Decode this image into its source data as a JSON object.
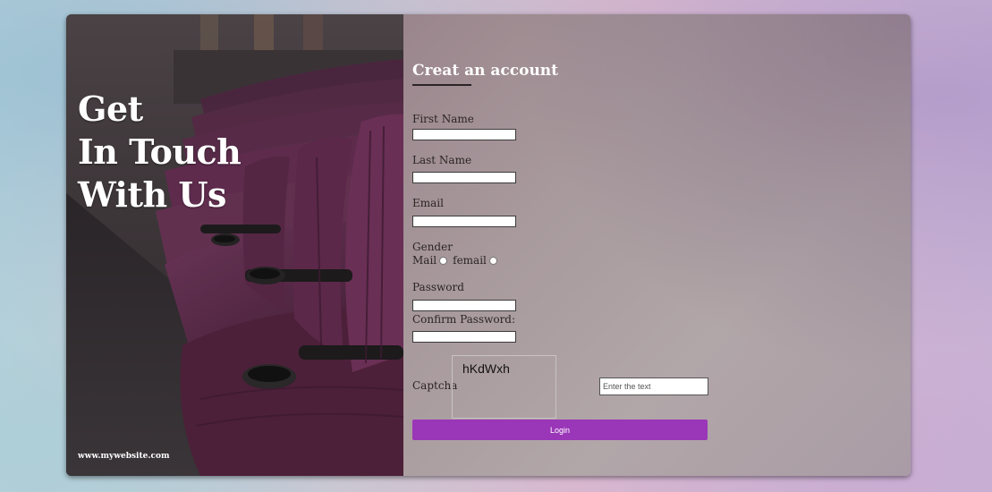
{
  "hero": {
    "title_lines": [
      "Get",
      "In Touch",
      "With Us"
    ],
    "website": "www.mywebsite.com"
  },
  "form": {
    "title": "Creat an account",
    "first_name_label": "First Name",
    "last_name_label": "Last Name",
    "email_label": "Email",
    "gender_label": "Gender",
    "gender_option_1": "Mail",
    "gender_option_2": "femail",
    "password_label": "Password",
    "confirm_password_label": "Confirm Password:",
    "captcha_label": "Captcha",
    "captcha_code": "hKdWxh",
    "captcha_placeholder": "Enter the text",
    "login_label": "Login"
  },
  "colors": {
    "accent": "#9a36b8",
    "seat": "#5a2a4a"
  }
}
